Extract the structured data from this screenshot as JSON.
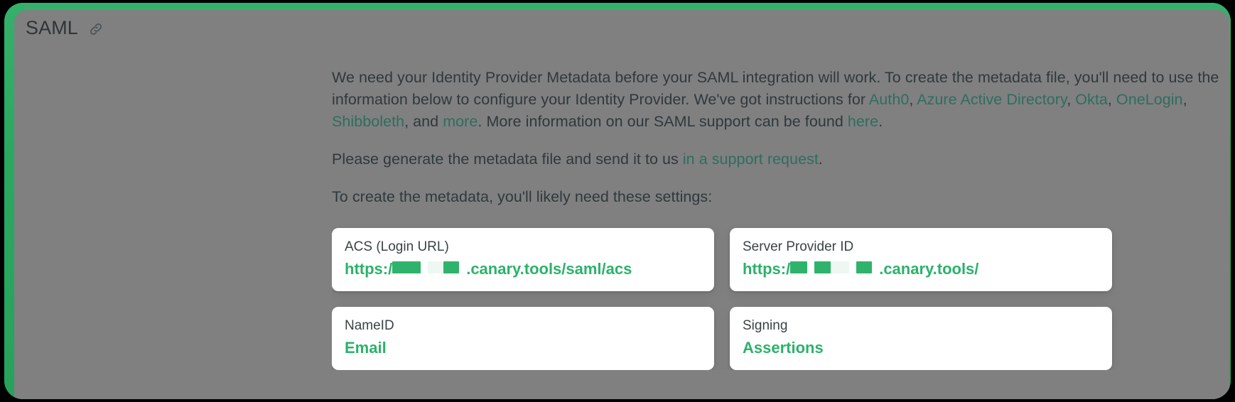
{
  "window": {
    "frame_color": "#2aa860",
    "overlay_color": "#808080"
  },
  "header": {
    "title": "SAML",
    "link_icon": "link-icon"
  },
  "paragraphs": {
    "p1": {
      "seg1": "We need your Identity Provider Metadata before your SAML integration will work. To create the metadata file, you'll need to use the information below to configure your Identity Provider. We've got instructions for ",
      "link_auth0": "Auth0",
      "sep1": ", ",
      "link_azure": "Azure Active Directory",
      "sep2": ", ",
      "link_okta": "Okta",
      "sep3": ", ",
      "link_onelogin": "OneLogin",
      "sep4": ", ",
      "link_shibboleth": "Shibboleth",
      "sep5": ", and ",
      "link_more": "more",
      "seg2": ". More information on our SAML support can be found ",
      "link_here": "here",
      "seg3": "."
    },
    "p2": {
      "seg1": "Please generate the metadata file and send it to us ",
      "link_support": "in a support request",
      "seg2": "."
    },
    "p3": {
      "seg1": "To create the metadata, you'll likely need these settings:"
    }
  },
  "cards": [
    {
      "label": "ACS (Login URL)",
      "value_prefix": "https:/",
      "value_suffix": ".canary.tools/saml/acs",
      "redacted": true
    },
    {
      "label": "Server Provider ID",
      "value_prefix": "https:/",
      "value_suffix": ".canary.tools/",
      "redacted": true
    },
    {
      "label": "NameID",
      "value_prefix": "Email",
      "value_suffix": "",
      "redacted": false
    },
    {
      "label": "Signing",
      "value_prefix": "Assertions",
      "value_suffix": "",
      "redacted": false
    }
  ],
  "colors": {
    "link": "#2e6d5d",
    "value_green": "#2bb26a",
    "text": "#30383c",
    "frame_green": "#2aa860"
  }
}
